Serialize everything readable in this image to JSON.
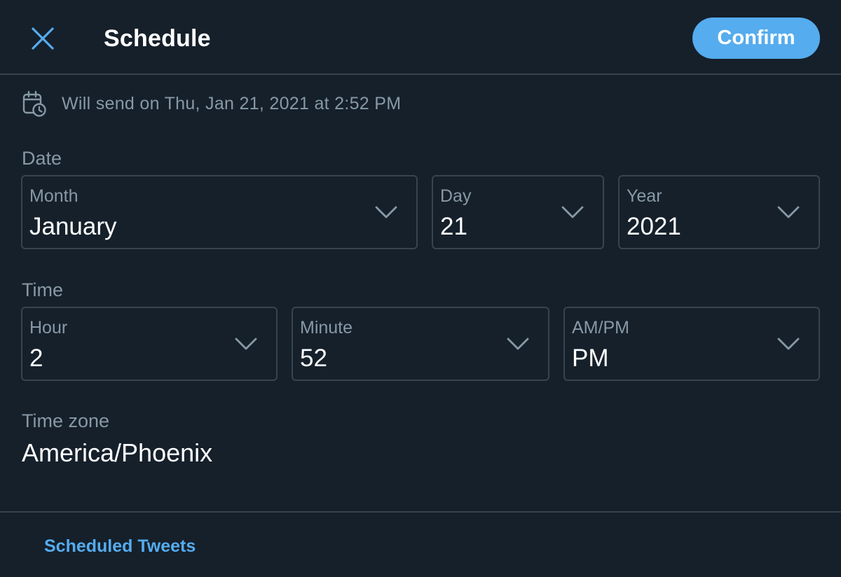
{
  "dialog": {
    "title": "Schedule",
    "confirm_label": "Confirm",
    "send_info": "Will send on Thu, Jan 21, 2021 at 2:52 PM"
  },
  "date": {
    "section_label": "Date",
    "month": {
      "label": "Month",
      "value": "January"
    },
    "day": {
      "label": "Day",
      "value": "21"
    },
    "year": {
      "label": "Year",
      "value": "2021"
    }
  },
  "time": {
    "section_label": "Time",
    "hour": {
      "label": "Hour",
      "value": "2"
    },
    "minute": {
      "label": "Minute",
      "value": "52"
    },
    "ampm": {
      "label": "AM/PM",
      "value": "PM"
    }
  },
  "timezone": {
    "label": "Time zone",
    "value": "America/Phoenix"
  },
  "footer": {
    "link_label": "Scheduled Tweets"
  },
  "colors": {
    "background": "#15202b",
    "border": "#38444d",
    "accent": "#55acee",
    "muted_text": "#8899a6",
    "text": "#ffffff"
  },
  "icons": {
    "close": "close-icon",
    "calendar": "calendar-clock-icon",
    "chevron": "chevron-down-icon"
  }
}
